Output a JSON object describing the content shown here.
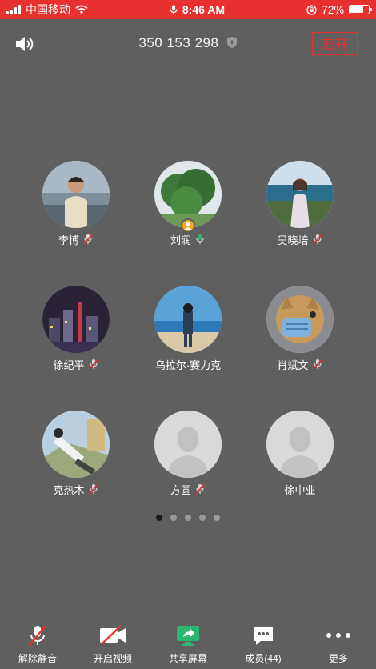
{
  "status_bar": {
    "carrier": "中国移动",
    "time": "8:46 AM",
    "battery_percent": "72%",
    "battery_level": 0.72
  },
  "header": {
    "meeting_id": "350 153 298",
    "leave_label": "离开"
  },
  "participants": [
    {
      "name": "李博",
      "muted": true
    },
    {
      "name": "刘润",
      "muted": false,
      "host": true
    },
    {
      "name": "吴晓培",
      "muted": true
    },
    {
      "name": "徐纪平",
      "muted": true
    },
    {
      "name": "乌拉尔·赛力克",
      "muted": false
    },
    {
      "name": "肖斌文",
      "muted": true
    },
    {
      "name": "克热木",
      "muted": true
    },
    {
      "name": "方圆",
      "muted": true
    },
    {
      "name": "徐中业",
      "muted": false
    }
  ],
  "pagination": {
    "total": 5,
    "current": 1
  },
  "toolbar": {
    "unmute": "解除静音",
    "start_video": "开启视频",
    "share_screen": "共享屏幕",
    "members": "成员(44)",
    "more": "更多"
  },
  "colors": {
    "accent_red": "#e8312f",
    "background": "#5f5f5f",
    "share_green": "#2bb673",
    "host_badge": "#f5a623"
  }
}
